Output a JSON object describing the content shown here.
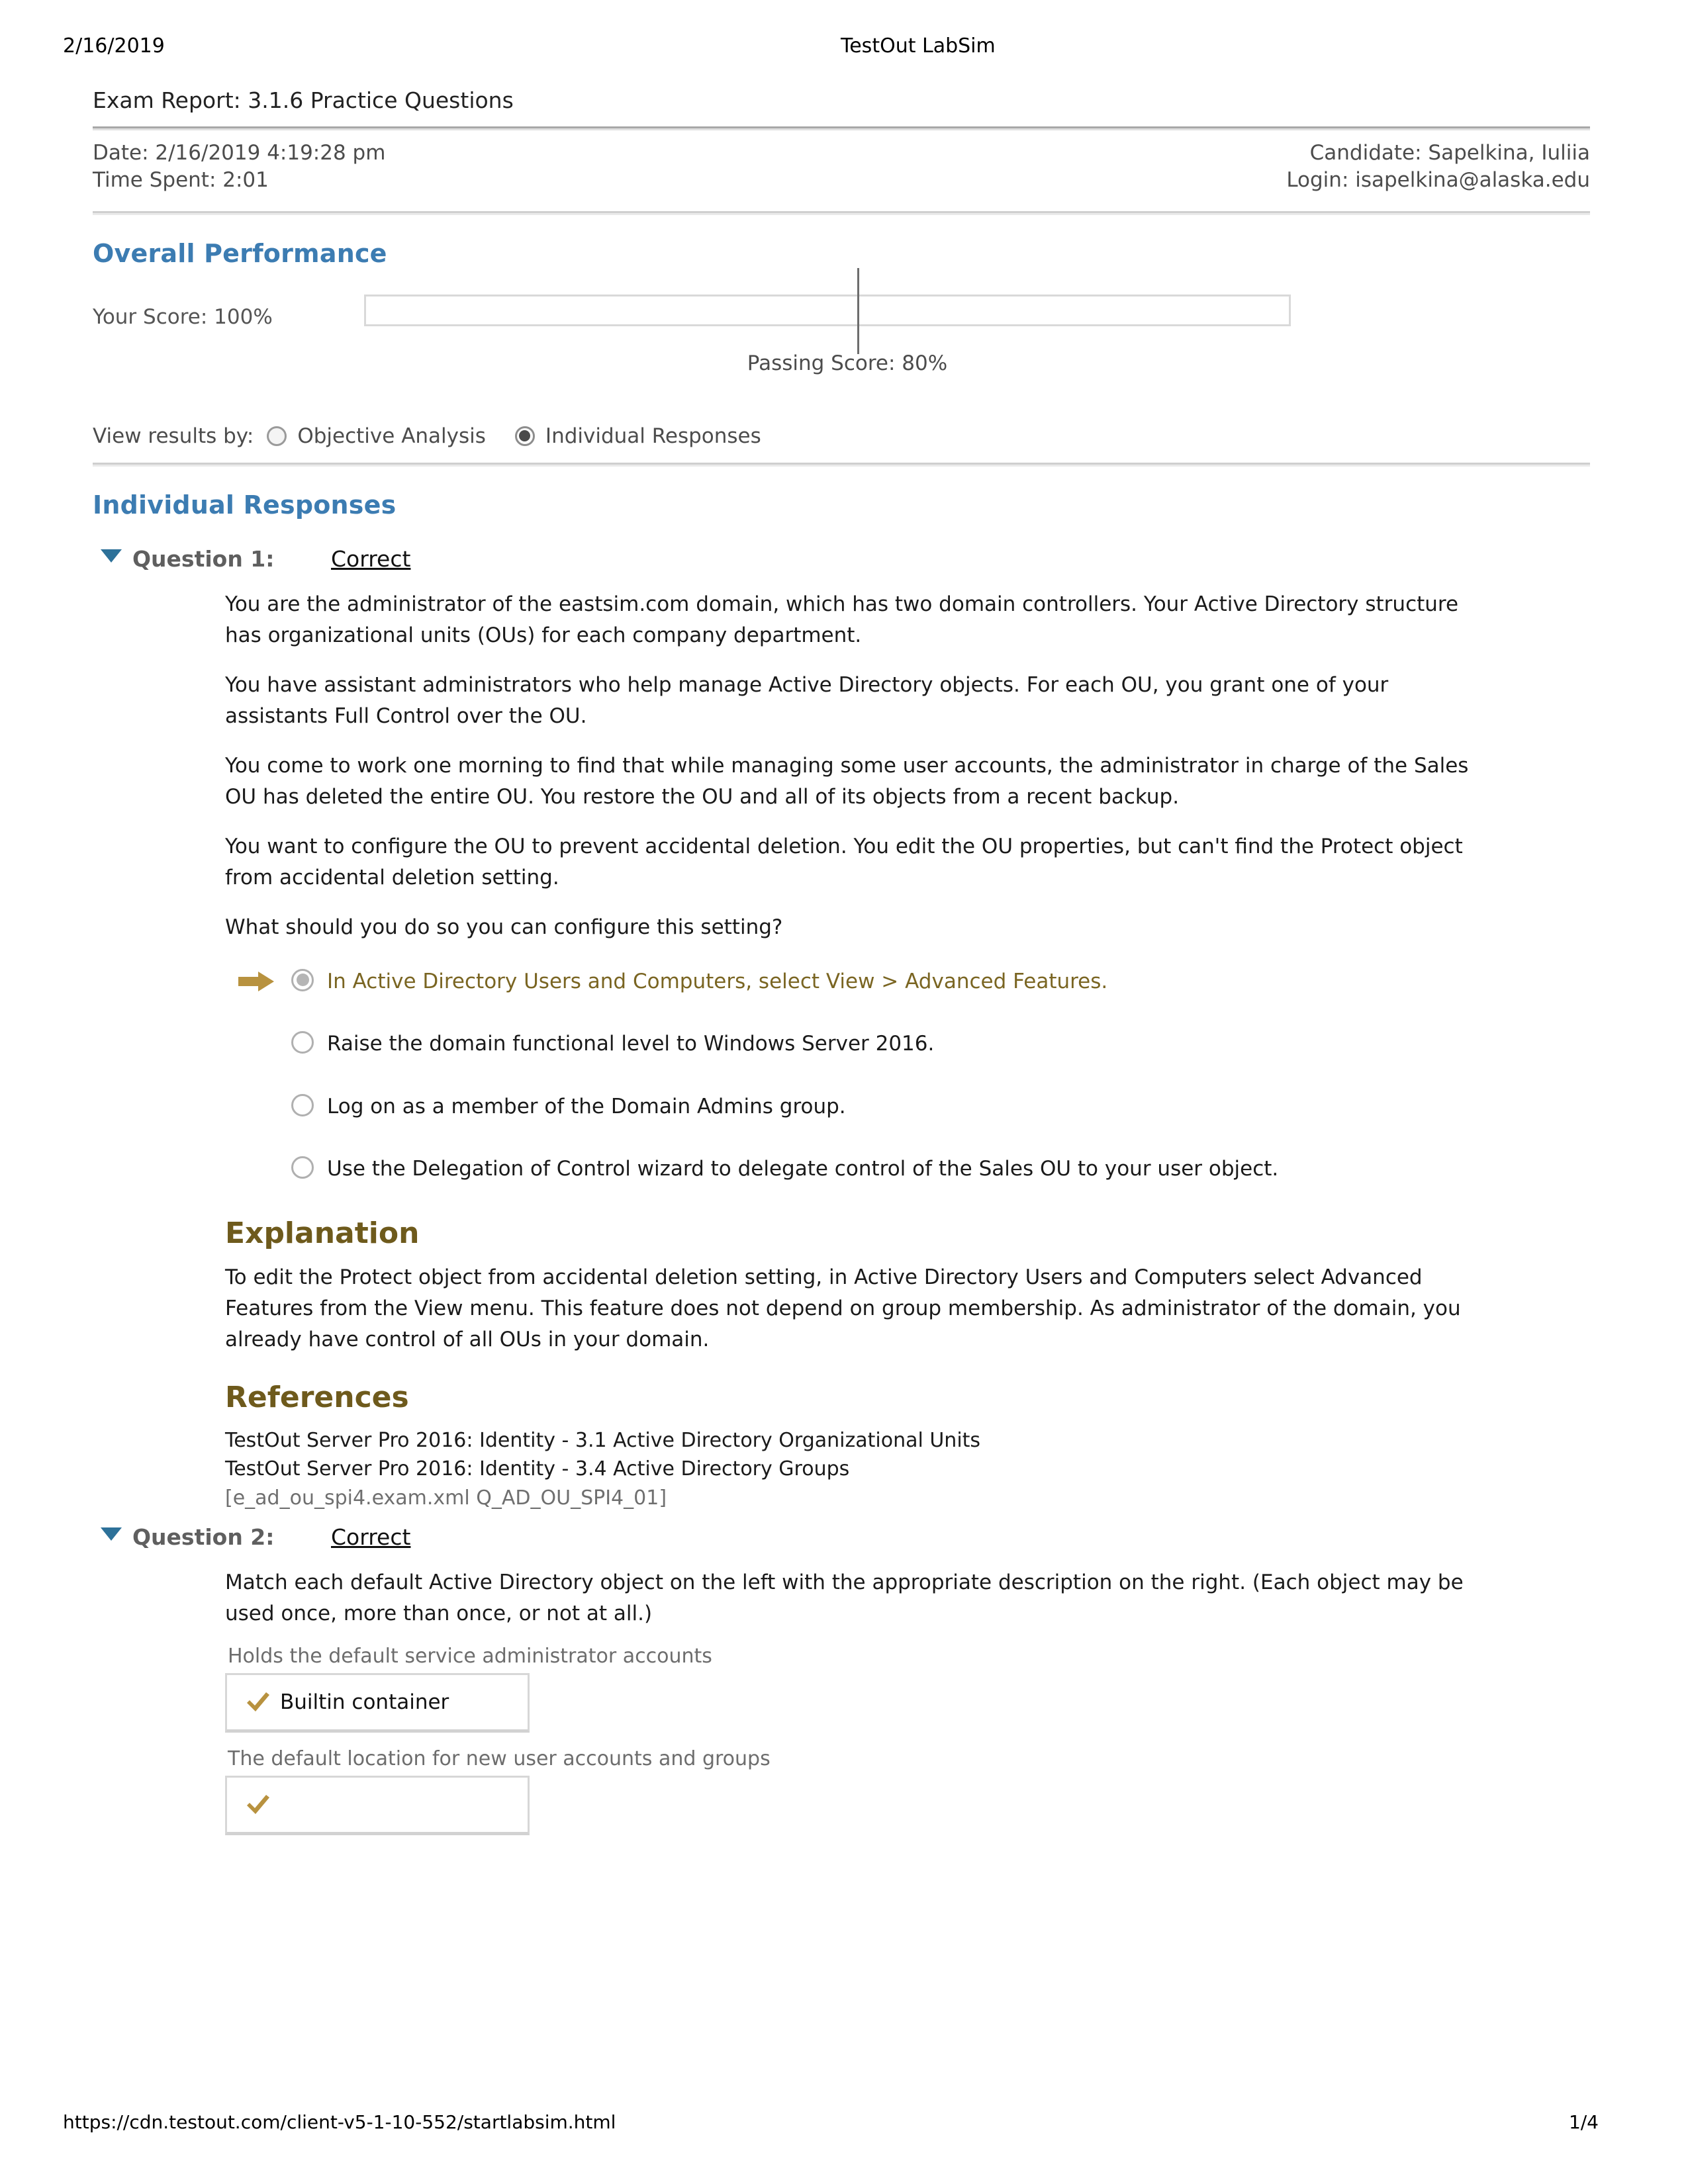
{
  "print_header": {
    "date": "2/16/2019",
    "title": "TestOut LabSim"
  },
  "print_footer": {
    "url": "https://cdn.testout.com/client-v5-1-10-552/startlabsim.html",
    "page": "1/4"
  },
  "report": {
    "title": "Exam Report: 3.1.6 Practice Questions",
    "date_line": "Date: 2/16/2019 4:19:28 pm",
    "time_spent_line": "Time Spent: 2:01",
    "candidate_line": "Candidate: Sapelkina, Iuliia",
    "login_line": "Login: isapelkina@alaska.edu"
  },
  "overall_performance": {
    "heading": "Overall Performance",
    "your_score_label": "Your Score:  100%",
    "your_score_value": 100,
    "passing_score_label": "Passing Score:  80%",
    "passing_score_value": 80
  },
  "view_results": {
    "label": "View results by:",
    "options": [
      {
        "label": "Objective Analysis",
        "selected": false
      },
      {
        "label": "Individual Responses",
        "selected": true
      }
    ]
  },
  "individual_responses": {
    "heading": "Individual Responses"
  },
  "question1": {
    "number_label": "Question 1:",
    "status": "Correct",
    "paragraphs": [
      "You are the administrator of the eastsim.com domain, which has two domain controllers. Your Active Directory structure has organizational units (OUs) for each company department.",
      "You have assistant administrators who help manage Active Directory objects. For each OU, you grant one of your assistants Full Control over the OU.",
      "You come to work one morning to find that while managing some user accounts, the administrator in charge of the Sales OU has deleted the entire OU. You restore the OU and all of its objects from a recent backup.",
      "You want to configure the OU to prevent accidental deletion. You edit the OU properties, but can't find the Protect object from accidental deletion setting.",
      "What should you do so you can configure this setting?"
    ],
    "answers": [
      {
        "text": "In Active Directory Users and Computers, select View > Advanced Features.",
        "selected": true,
        "marked": true
      },
      {
        "text": "Raise the domain functional level to Windows Server 2016.",
        "selected": false,
        "marked": false
      },
      {
        "text": "Log on as a member of the Domain Admins group.",
        "selected": false,
        "marked": false
      },
      {
        "text": "Use the Delegation of Control wizard to delegate control of the Sales OU to your user object.",
        "selected": false,
        "marked": false
      }
    ],
    "explanation_heading": "Explanation",
    "explanation_text": "To edit the Protect object from accidental deletion setting, in Active Directory Users and Computers select Advanced Features from the View menu. This feature does not depend on group membership. As administrator of the domain, you already have control of all OUs in your domain.",
    "references_heading": "References",
    "references": [
      "TestOut Server Pro 2016: Identity - 3.1 Active Directory Organizational Units",
      "TestOut Server Pro 2016: Identity - 3.4 Active Directory Groups"
    ],
    "exam_id": "[e_ad_ou_spi4.exam.xml Q_AD_OU_SPI4_01]"
  },
  "question2": {
    "number_label": "Question 2:",
    "status": "Correct",
    "paragraphs": [
      "Match each default Active Directory object on the left with the appropriate description on the right. (Each object may be used once, more than once, or not at all.)"
    ],
    "matches": [
      {
        "prompt": "Holds the default service administrator accounts",
        "answer": "Builtin container",
        "correct": true
      },
      {
        "prompt": "The default location for new user accounts and groups",
        "answer": "",
        "correct": true
      }
    ]
  },
  "colors": {
    "accent_blue": "#3c7cb2",
    "accent_brown": "#6e5a1c",
    "gold": "#b8923f",
    "triangle_blue": "#2d7199"
  }
}
